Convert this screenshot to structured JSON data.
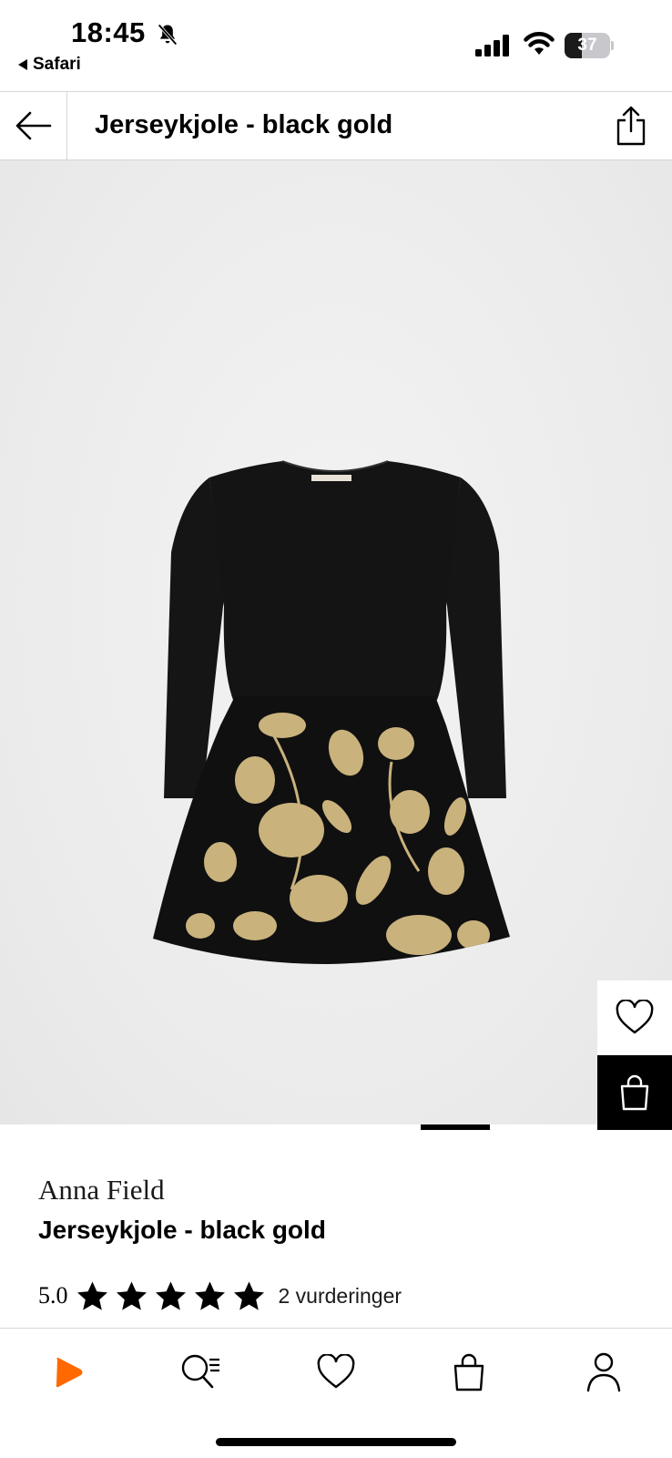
{
  "status_bar": {
    "time": "18:45",
    "back_app": "Safari",
    "battery_percent": "37",
    "battery_level": 0.37
  },
  "header": {
    "title": "Jerseykjole - black gold"
  },
  "image_carousel": {
    "image_count": 2,
    "active_index": 0
  },
  "product": {
    "brand": "Anna Field",
    "name": "Jerseykjole - black gold",
    "rating_value": "5.0",
    "rating_stars": 5,
    "rating_count": "2 vurderinger"
  },
  "tab_bar": {
    "items": [
      "home-icon",
      "search-icon",
      "wishlist-icon",
      "bag-icon",
      "profile-icon"
    ],
    "accent": "#ff6900"
  },
  "colors": {
    "accent": "#ff6900",
    "image_background": "#ebebeb",
    "dress_black": "#111111",
    "dress_gold": "#c9b27c"
  }
}
